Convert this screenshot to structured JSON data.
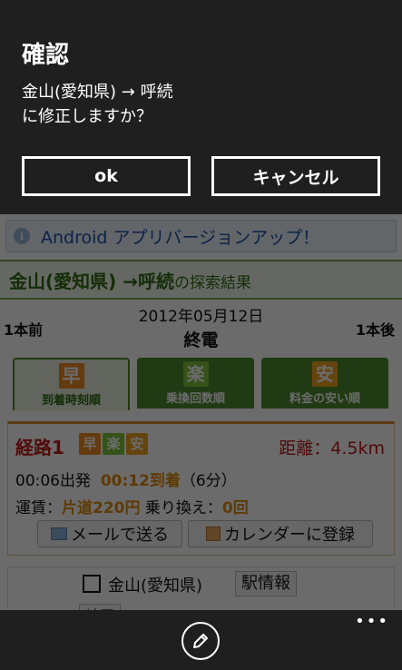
{
  "dialog": {
    "title": "確認",
    "message_line1": "金山(愛知県) → 呼続",
    "message_line2": "に修正しますか？",
    "ok_label": "ok",
    "cancel_label": "キャンセル"
  },
  "page": {
    "banner_text": "Android アプリバージョンアップ！",
    "result_title": "金山(愛知県) →呼続",
    "result_suffix": "の探索結果",
    "nav": {
      "prev": "1本前",
      "next": "1本後",
      "date": "2012年05月12日",
      "last_train": "終電"
    },
    "tabs": [
      {
        "icon": "早",
        "label": "到着時刻順"
      },
      {
        "icon": "楽",
        "label": "乗換回数順"
      },
      {
        "icon": "安",
        "label": "料金の安い順"
      }
    ],
    "route": {
      "title": "経路1",
      "badges": [
        "早",
        "楽",
        "安"
      ],
      "distance": "距離：4.5km",
      "depart": "00:06出発",
      "arrive": "00:12到着",
      "duration": "（6分）",
      "fare_label": "運賃：",
      "fare_value": "片道220円",
      "transfer_label": "乗り換え：",
      "transfer_value": "0回",
      "mail_button": "メールで送る",
      "calendar_button": "カレンダーに登録"
    },
    "station": {
      "name": "金山(愛知県)",
      "info_button": "駅情報",
      "map_button": "地図"
    }
  },
  "appbar": {
    "more": "•••",
    "edit_icon": "pencil-icon"
  },
  "colors": {
    "dialog_bg": "#1f1f1f",
    "route_red": "#c01818",
    "accent_green": "#4c8a2e",
    "accent_orange": "#e08a10"
  }
}
